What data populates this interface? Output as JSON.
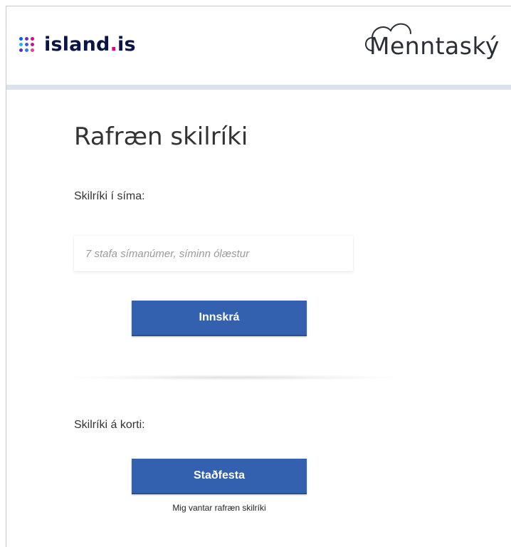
{
  "header": {
    "island_logo": {
      "name": "island",
      "dot": ".",
      "suffix": "is",
      "dot_colors": [
        "#0061ff",
        "#6a2ec8",
        "#e6007e",
        "#1bb8e8",
        "#3b5bdb",
        "#c2178f",
        "#5c2fc2",
        "#2b7bff",
        "#e83e8c"
      ],
      "accent_color": "#e6007e",
      "text_color": "#0a1446"
    },
    "partner_logo": {
      "text": "Menntaský",
      "icon": "cloud-icon"
    }
  },
  "main": {
    "title": "Rafræn skilríki",
    "phone_section": {
      "label": "Skilríki í síma:",
      "input_placeholder": "7 stafa símanúmer, síminn ólæstur",
      "input_value": "",
      "button_label": "Innskrá"
    },
    "card_section": {
      "label": "Skilríki á korti:",
      "button_label": "Staðfesta",
      "help_link": "Mig vantar rafræn skilríki"
    }
  },
  "colors": {
    "button": "#3361b0",
    "header_line": "#dbe2ec",
    "text": "#333333"
  }
}
